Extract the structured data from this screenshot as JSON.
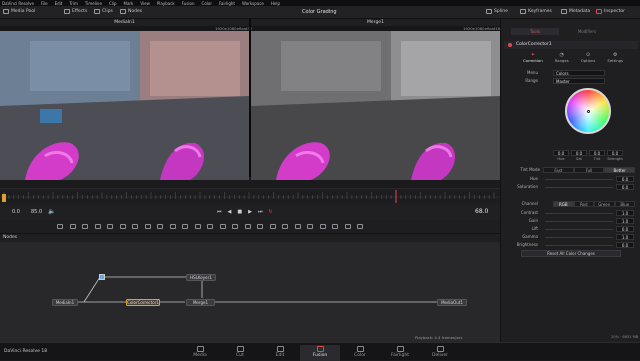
{
  "menubar": {
    "items": [
      "DaVinci Resolve",
      "File",
      "Edit",
      "Trim",
      "Timeline",
      "Clip",
      "Mark",
      "View",
      "Playback",
      "Fusion",
      "Color",
      "Fairlight",
      "Workspace",
      "Help"
    ]
  },
  "toolbar": {
    "media_pool": "Media Pool",
    "effects": "Effects",
    "clips": "Clips",
    "nodes": "Nodes",
    "title": "Color Grading",
    "spline": "Spline",
    "keyframes": "Keyframes",
    "metadata": "Metadata",
    "inspector": "Inspector"
  },
  "viewers": {
    "left": {
      "title": "MediaIn1",
      "resolution": "1920x1080xfloat32"
    },
    "right": {
      "title": "Merge1",
      "resolution": "1920x1080xfloat16"
    }
  },
  "transport": {
    "start_time": "0.0",
    "end_time": "85.0",
    "current_frame": "68.0"
  },
  "nodes_panel": {
    "title": "Nodes",
    "nodes": [
      "MediaIn1",
      "ColorCorrector1",
      "Merge1",
      "HSLKeyer1",
      "MediaOut1"
    ]
  },
  "inspector": {
    "tabs": [
      "Tools",
      "Modifiers"
    ],
    "node_name": "ColorCorrector1",
    "subtabs": [
      "Correction",
      "Ranges",
      "Options",
      "Settings"
    ],
    "menu_label": "Menu",
    "menu_value": "Colors",
    "range_label": "Range",
    "range_value": "Master",
    "color_values": [
      "0.0",
      "0.0",
      "0.0",
      "0.0"
    ],
    "color_value_labels": [
      "Hue",
      "Sat",
      "Tint",
      "Strength"
    ],
    "tint_mode_label": "Tint Mode",
    "tint_mode_options": [
      "Fast",
      "Full",
      "Better"
    ],
    "hue_label": "Hue",
    "hue_value": "0.0",
    "saturation_label": "Saturation",
    "saturation_value": "0.0",
    "channel_label": "Channel",
    "channel_options": [
      "RGB",
      "Red",
      "Green",
      "Blue"
    ],
    "contrast_label": "Contrast",
    "contrast_value": "1.0",
    "gain_label": "Gain",
    "gain_value": "1.0",
    "lift_label": "Lift",
    "lift_value": "0.0",
    "gamma_label": "Gamma",
    "gamma_value": "1.0",
    "brightness_label": "Brightness",
    "brightness_value": "0.0",
    "reset_button": "Reset All Color Changes"
  },
  "status": {
    "playback": "Playback: 4.4 frames/sec",
    "memory": "20% · 6631 MB"
  },
  "pages": {
    "app_name": "DaVinci Resolve 18",
    "items": [
      "Media",
      "Cut",
      "Edit",
      "Fusion",
      "Color",
      "Fairlight",
      "Deliver"
    ],
    "active": "Fusion"
  },
  "colors": {
    "accent": "#e24a4a",
    "selected_node": "#e0a030",
    "node_wire": "#c9c9cc"
  }
}
